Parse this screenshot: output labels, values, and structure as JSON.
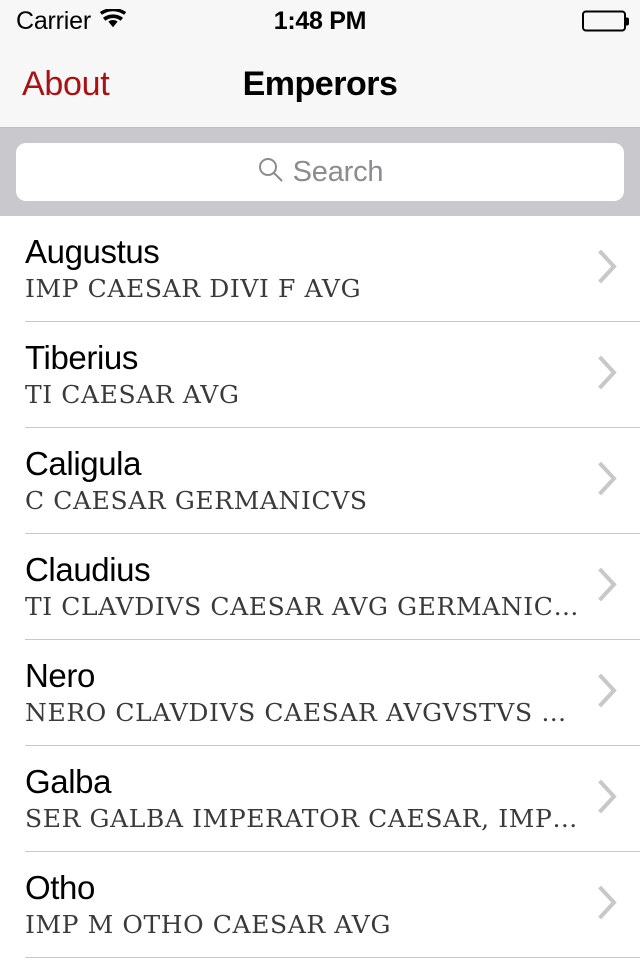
{
  "status_bar": {
    "carrier": "Carrier",
    "wifi_icon": "wifi-icon",
    "time": "1:48 PM",
    "battery_icon": "battery-full-icon"
  },
  "nav_bar": {
    "back_label": "About",
    "back_color": "#a81212",
    "title": "Emperors"
  },
  "search": {
    "placeholder": "Search",
    "value": "",
    "icon": "search-icon",
    "bar_background": "#c9c8cd"
  },
  "list": {
    "separator_color": "#c8c7cc",
    "chevron_color": "#c7c7cc",
    "rows": [
      {
        "title": "Augustus",
        "subtitle": "IMP CAESAR DIVI F AVG",
        "accessory": "chevron-right-icon"
      },
      {
        "title": "Tiberius",
        "subtitle": "TI CAESAR AVG",
        "accessory": "chevron-right-icon"
      },
      {
        "title": "Caligula",
        "subtitle": "C CAESAR GERMANICVS",
        "accessory": "chevron-right-icon"
      },
      {
        "title": "Claudius",
        "subtitle": "TI CLAVDIVS CAESAR AVG GERMANICVS",
        "accessory": "chevron-right-icon"
      },
      {
        "title": "Nero",
        "subtitle": "NERO CLAVDIVS CAESAR AVGVSTVS G…",
        "accessory": "chevron-right-icon"
      },
      {
        "title": "Galba",
        "subtitle": "SER GALBA IMPERATOR CAESAR, IMP S…",
        "accessory": "chevron-right-icon"
      },
      {
        "title": "Otho",
        "subtitle": "IMP M OTHO CAESAR AVG",
        "accessory": "chevron-right-icon"
      }
    ]
  }
}
